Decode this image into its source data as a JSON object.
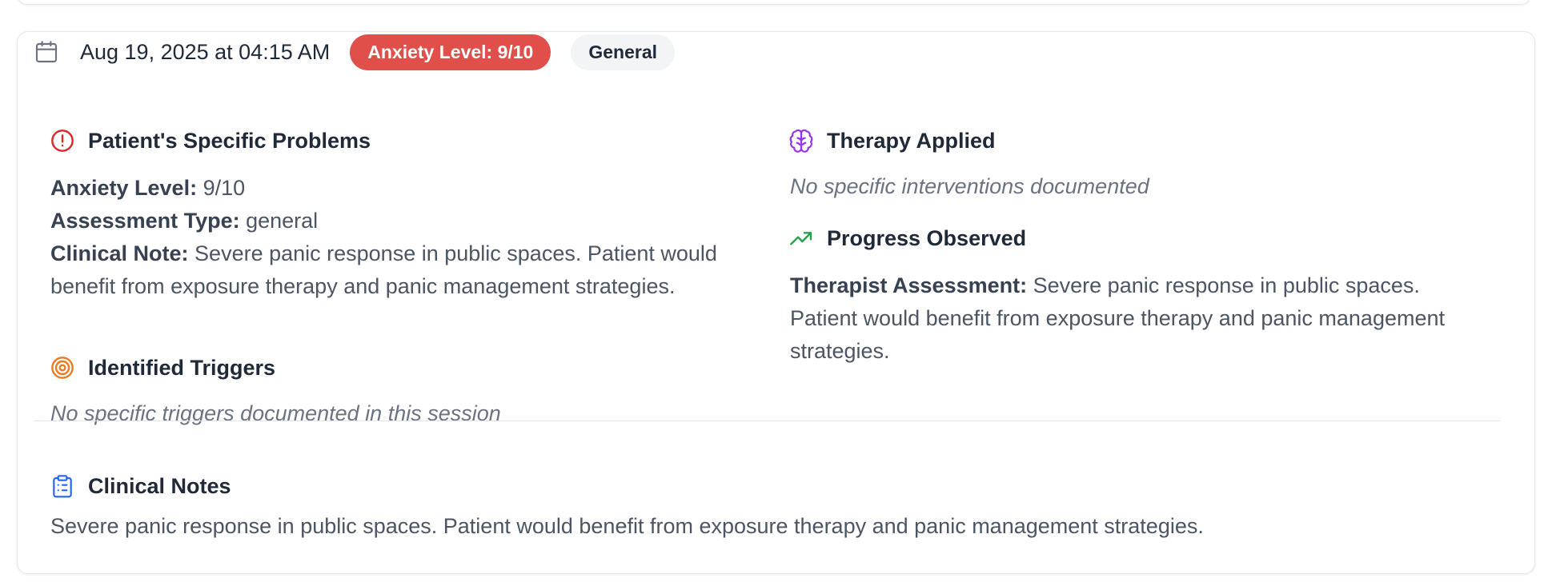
{
  "session": {
    "date": "Aug 19, 2025 at 04:15 AM",
    "anxiety_badge": "Anxiety Level: 9/10",
    "category_badge": "General",
    "colors": {
      "anxiety_badge_bg": "#e04f4a",
      "category_badge_bg": "#f3f4f6"
    }
  },
  "problems": {
    "title": "Patient's Specific Problems",
    "anxiety_label": "Anxiety Level:",
    "anxiety_value": "9/10",
    "assessment_label": "Assessment Type:",
    "assessment_value": "general",
    "note_label": "Clinical Note:",
    "note_value": "Severe panic response in public spaces. Patient would benefit from exposure therapy and panic management strategies."
  },
  "triggers": {
    "title": "Identified Triggers",
    "empty_text": "No specific triggers documented in this session"
  },
  "therapy": {
    "title": "Therapy Applied",
    "empty_text": "No specific interventions documented"
  },
  "progress": {
    "title": "Progress Observed",
    "assessment_label": "Therapist Assessment:",
    "assessment_value": "Severe panic response in public spaces. Patient would benefit from exposure therapy and panic management strategies."
  },
  "clinical_notes": {
    "title": "Clinical Notes",
    "text": "Severe panic response in public spaces. Patient would benefit from exposure therapy and panic management strategies."
  },
  "icons": {
    "date": "calendar-icon",
    "problems": "alert-circle-icon",
    "triggers": "target-icon",
    "therapy": "brain-icon",
    "progress": "trending-up-icon",
    "notes": "clipboard-list-icon"
  }
}
